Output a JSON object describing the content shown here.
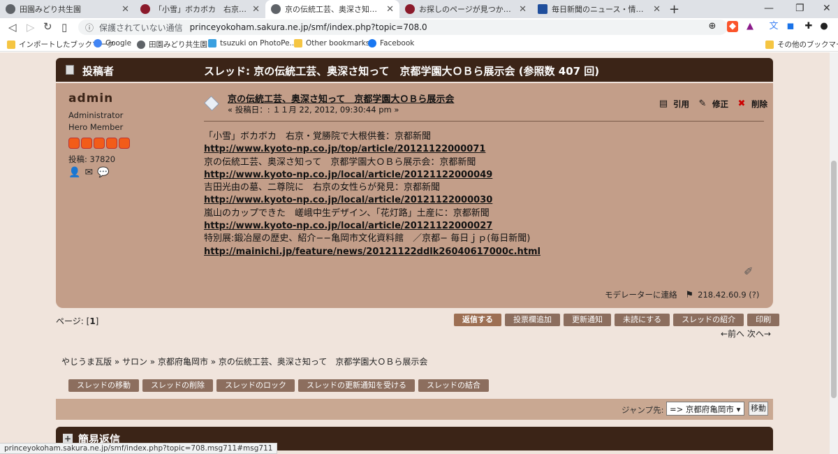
{
  "browser": {
    "tabs": [
      {
        "title": "田園みどり共生園",
        "fav_color": "#5f6368"
      },
      {
        "title": "「小雪」ボカボカ　右京・覚勝院で大根",
        "fav_color": "#8b1a2b"
      },
      {
        "title": "京の伝統工芸、奥深さ知って　京都学",
        "fav_color": "#5f6368"
      },
      {
        "title": "お探しのページが見つかりません|京都新",
        "fav_color": "#8b1a2b"
      },
      {
        "title": "毎日新聞のニュース・情報サイト",
        "fav_color": "#1f4e9c"
      }
    ],
    "security_label": "保護されていない通信",
    "url": "princeyokoham.sakura.ne.jp/smf/index.php?topic=708.0",
    "bookmarks": [
      {
        "label": "インポートしたブックマーク",
        "color": "#f5c542"
      },
      {
        "label": "Google",
        "color": "#4285f4"
      },
      {
        "label": "田園みどり共生園",
        "color": "#5f6368"
      },
      {
        "label": "tsuzuki on PhotoPe...",
        "color": "#3aa0e0"
      },
      {
        "label": "Other bookmarks",
        "color": "#f5c542"
      },
      {
        "label": "Facebook",
        "color": "#1877f2"
      }
    ],
    "other_bookmarks": "その他のブックマーク",
    "status_url": "princeyokoham.sakura.ne.jp/smf/index.php?topic=708.msg711#msg711"
  },
  "header": {
    "poster_label": "投稿者",
    "thread_title": "スレッド: 京の伝統工芸、奥深さ知って　京都学園大ＯＢら展示会  (参照数 407 回)"
  },
  "post": {
    "author": "admin",
    "rank_lines": [
      "Administrator",
      "Hero Member"
    ],
    "post_count": "投稿: 37820",
    "subject": "京の伝統工芸、奥深さ知って　京都学園大ＯＢら展示会",
    "date": "« 投稿日：: １１月 22, 2012, 09:30:44 pm »",
    "actions": {
      "quote": "引用",
      "modify": "修正",
      "delete": "削除"
    },
    "lines": [
      {
        "text": "「小雪」ボカボカ　右京・覚勝院で大根供養：京都新聞",
        "link": false
      },
      {
        "text": "http://www.kyoto-np.co.jp/top/article/20121122000071",
        "link": true
      },
      {
        "text": "京の伝統工芸、奥深さ知って　京都学園大ＯＢら展示会：京都新聞",
        "link": false
      },
      {
        "text": "http://www.kyoto-np.co.jp/local/article/20121122000049",
        "link": true
      },
      {
        "text": "吉田光由の墓、二尊院に　右京の女性らが発見：京都新聞",
        "link": false
      },
      {
        "text": "http://www.kyoto-np.co.jp/local/article/20121122000030",
        "link": true
      },
      {
        "text": "嵐山のカップできた　嵯峨中生デザイン、「花灯路」土産に：京都新聞",
        "link": false
      },
      {
        "text": "http://www.kyoto-np.co.jp/local/article/20121122000027",
        "link": true
      },
      {
        "text": "特別展:鍛冶屋の歴史、紹介−−亀岡市文化資料館　／京都− 毎日ｊｐ(毎日新聞)",
        "link": false
      },
      {
        "text": "http://mainichi.jp/feature/news/20121122ddlk26040617000c.html",
        "link": true
      }
    ],
    "moderator_link": "モデレーターに連絡",
    "ip": "218.42.60.9 (?)"
  },
  "pagination": {
    "label": "ページ: [",
    "current": "1",
    "close": "]"
  },
  "buttons": [
    "返信する",
    "投票欄追加",
    "更新通知",
    "未読にする",
    "スレッドの紹介",
    "印刷"
  ],
  "prevnext": "←前へ 次へ→",
  "breadcrumbs": "やじうま瓦版 » サロン » 京都府亀岡市 » 京の伝統工芸、奥深さ知って　京都学園大ＯＢら展示会",
  "mod_buttons": [
    "スレッドの移動",
    "スレッドの削除",
    "スレッドのロック",
    "スレッドの更新通知を受ける",
    "スレッドの結合"
  ],
  "jump": {
    "label": "ジャンプ先:",
    "selected": "=> 京都府亀岡市",
    "go": "移動"
  },
  "quick_reply": {
    "title": "簡易返信"
  }
}
